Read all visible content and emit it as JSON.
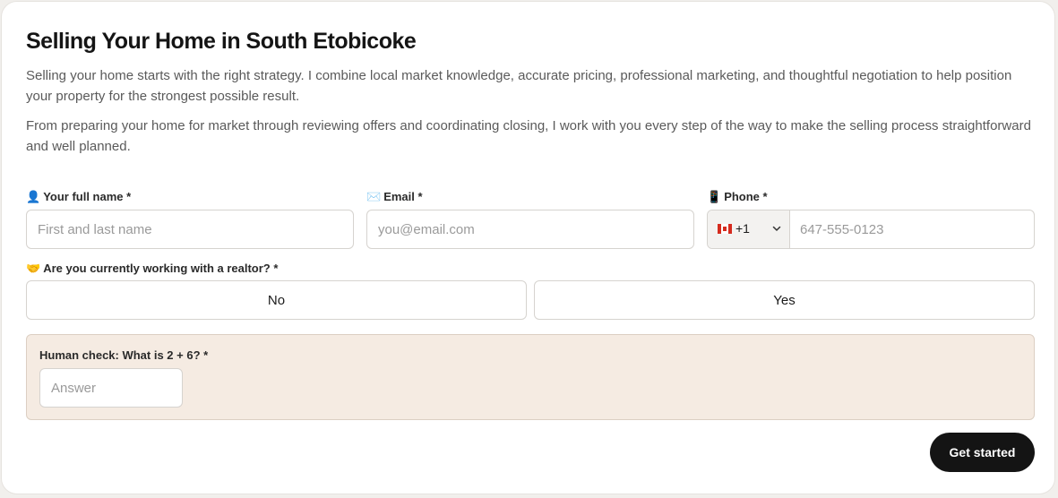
{
  "heading": "Selling Your Home in South Etobicoke",
  "paragraphs": [
    "Selling your home starts with the right strategy. I combine local market knowledge, accurate pricing, professional marketing, and thoughtful negotiation to help position your property for the strongest possible result.",
    "From preparing your home for market through reviewing offers and coordinating closing, I work with you every step of the way to make the selling process straightforward and well planned."
  ],
  "form": {
    "name": {
      "emoji": "👤",
      "label": "Your full name *",
      "placeholder": "First and last name",
      "value": ""
    },
    "email": {
      "emoji": "✉️",
      "label": "Email *",
      "placeholder": "you@email.com",
      "value": ""
    },
    "phone": {
      "emoji": "📱",
      "label": "Phone *",
      "country_flag": "canada-flag-icon",
      "dial_code": "+1",
      "placeholder": "647-555-0123",
      "value": ""
    },
    "realtor": {
      "emoji": "🤝",
      "label": "Are you currently working with a realtor? *",
      "options": [
        "No",
        "Yes"
      ]
    },
    "human_check": {
      "label": "Human check: What is 2 + 6? *",
      "placeholder": "Answer",
      "value": ""
    },
    "submit_label": "Get started"
  },
  "colors": {
    "page_background": "#f1efec",
    "card_background": "#ffffff",
    "human_check_background": "#f5ebe2",
    "button_background": "#141414",
    "button_text": "#ffffff",
    "flag_red": "#d52b1e"
  }
}
